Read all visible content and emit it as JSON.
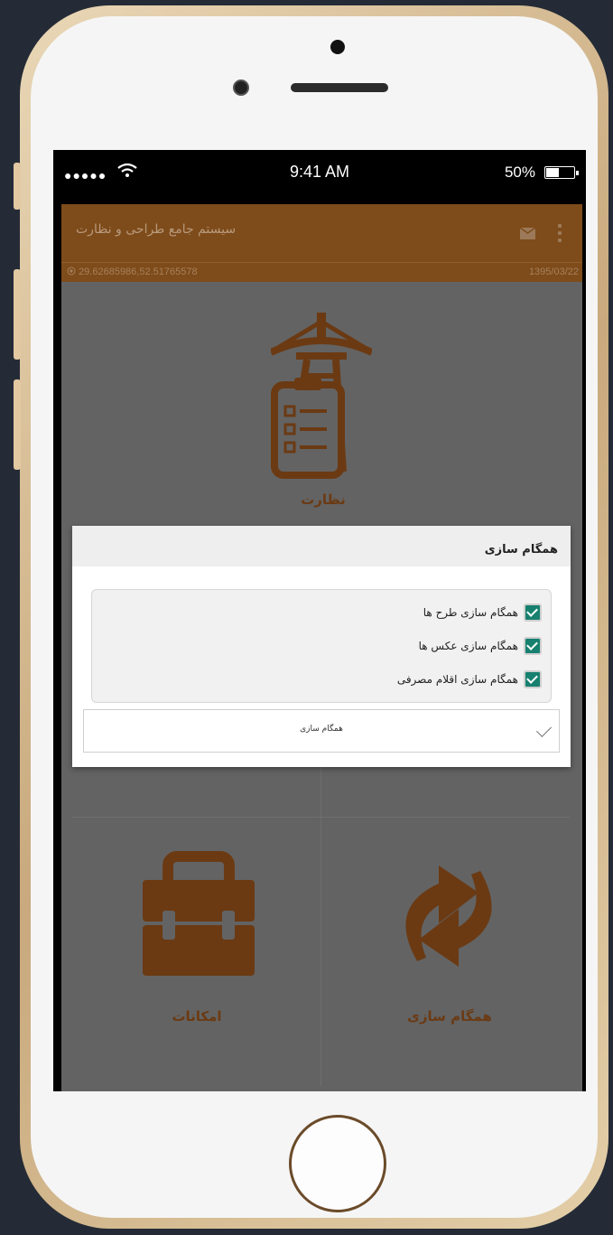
{
  "status": {
    "signal": "●●●●●",
    "time": "9:41 AM",
    "battery": "50%",
    "battery_level": 0.5
  },
  "appbar": {
    "title": "سیستم جامع طراحی و نظارت"
  },
  "infobar": {
    "coords": "29.62685986,52.51765578",
    "date": "1395/03/22"
  },
  "tiles": {
    "supervision": "نظارت",
    "features": "امکانات",
    "sync": "همگام سازی"
  },
  "dialog": {
    "title": "همگام سازی",
    "options": [
      {
        "label": "همگام سازی طرح ها",
        "checked": true
      },
      {
        "label": "همگام سازی عکس ها",
        "checked": true
      },
      {
        "label": "همگام سازی اقلام مصرفی",
        "checked": true
      }
    ],
    "button_label": "همگام سازی"
  },
  "colors": {
    "brand": "#7e4b1a",
    "icon": "#6b3a13",
    "checkbox": "#17806f"
  }
}
